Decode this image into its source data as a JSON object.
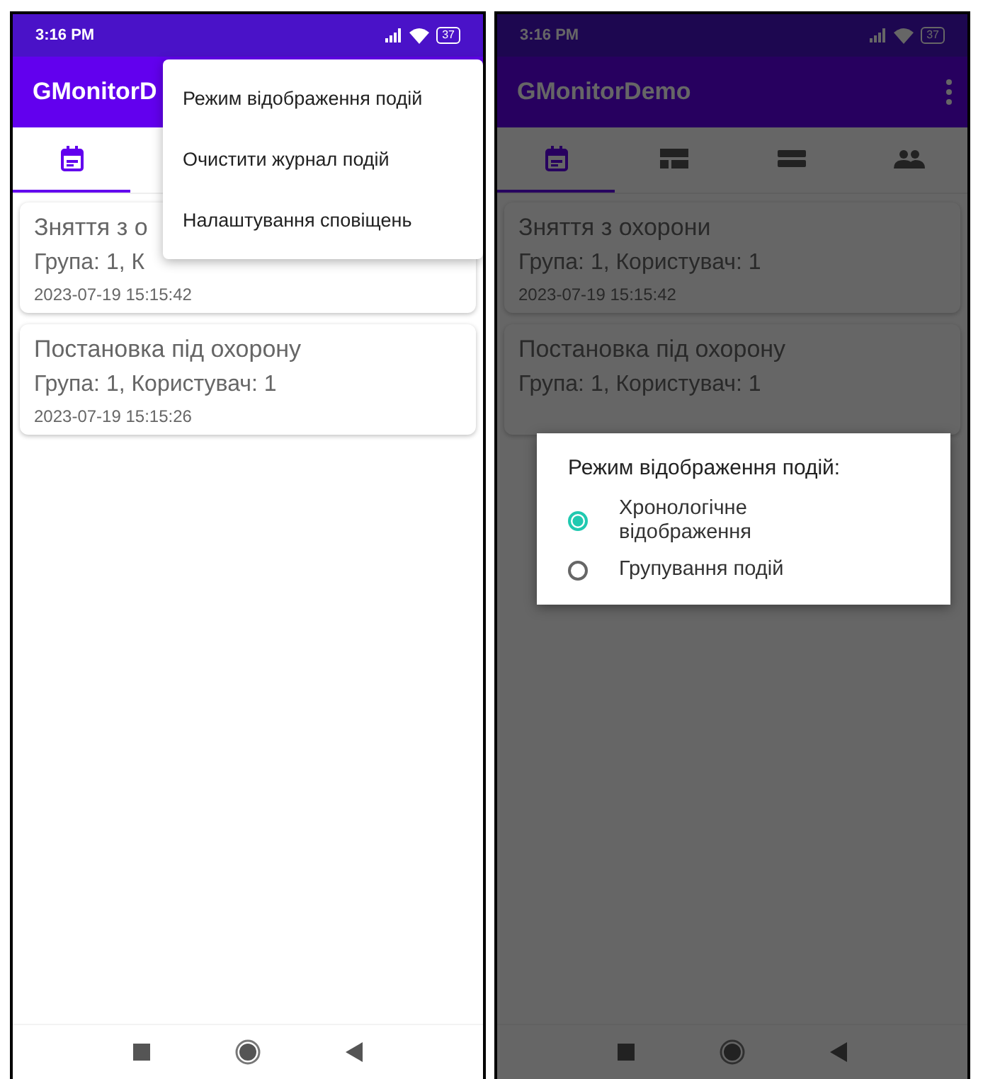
{
  "phones": [
    {
      "status_bar": {
        "time": "3:16 PM",
        "battery": "37"
      },
      "app_bar": {
        "title": "GMonitorD"
      },
      "tabs": [
        {
          "kind": "events",
          "selected": true
        }
      ],
      "events": [
        {
          "title": "Зняття з о",
          "details": "Група: 1, К",
          "time": "2023-07-19 15:15:42"
        },
        {
          "title": "Постановка під охорону",
          "details": "Група: 1, Користувач: 1",
          "time": "2023-07-19 15:15:26"
        }
      ],
      "popup_menu": {
        "items": [
          "Режим відображення подій",
          "Очистити журнал подій",
          "Налаштування сповіщень"
        ]
      },
      "scrim": false
    },
    {
      "status_bar": {
        "time": "3:16 PM",
        "battery": "37"
      },
      "app_bar": {
        "title": "GMonitorDemo",
        "overflow_button": true
      },
      "tabs": [
        {
          "kind": "events",
          "selected": true
        },
        {
          "kind": "zones",
          "selected": false
        },
        {
          "kind": "groups",
          "selected": false
        },
        {
          "kind": "users",
          "selected": false
        }
      ],
      "events": [
        {
          "title": "Зняття з охорони",
          "details": "Група: 1, Користувач: 1",
          "time": "2023-07-19 15:15:42"
        },
        {
          "title": "Постановка під охорону",
          "details": "Група: 1, Користувач: 1"
        }
      ],
      "dialog": {
        "title": "Режим відображення подій:",
        "options": [
          {
            "label": "Хронологічне відображення",
            "selected": true
          },
          {
            "label": "Групування подій",
            "selected": false
          }
        ]
      },
      "scrim": true
    }
  ]
}
